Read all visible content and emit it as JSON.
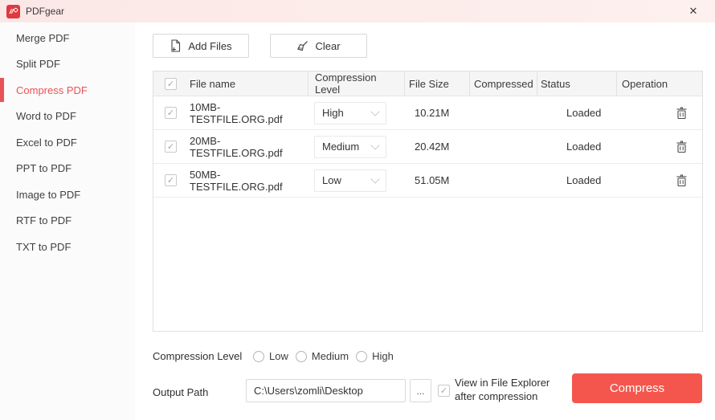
{
  "window": {
    "title": "PDFgear",
    "close_glyph": "✕"
  },
  "glyphs": {
    "check": "✓",
    "ellipsis": "..."
  },
  "sidebar": {
    "items": [
      {
        "label": "Merge PDF",
        "active": false
      },
      {
        "label": "Split PDF",
        "active": false
      },
      {
        "label": "Compress PDF",
        "active": true
      },
      {
        "label": "Word to PDF",
        "active": false
      },
      {
        "label": "Excel to PDF",
        "active": false
      },
      {
        "label": "PPT to PDF",
        "active": false
      },
      {
        "label": "Image to PDF",
        "active": false
      },
      {
        "label": "RTF to PDF",
        "active": false
      },
      {
        "label": "TXT to PDF",
        "active": false
      }
    ]
  },
  "toolbar": {
    "add_files_label": "Add Files",
    "clear_label": "Clear"
  },
  "table": {
    "columns": [
      "File name",
      "Compression Level",
      "File Size",
      "Compressed",
      "Status",
      "Operation"
    ],
    "rows": [
      {
        "checked": true,
        "file_name": "10MB-TESTFILE.ORG.pdf",
        "compression_level": "High",
        "file_size": "10.21M",
        "compressed": "",
        "status": "Loaded"
      },
      {
        "checked": true,
        "file_name": "20MB-TESTFILE.ORG.pdf",
        "compression_level": "Medium",
        "file_size": "20.42M",
        "compressed": "",
        "status": "Loaded"
      },
      {
        "checked": true,
        "file_name": "50MB-TESTFILE.ORG.pdf",
        "compression_level": "Low",
        "file_size": "51.05M",
        "compressed": "",
        "status": "Loaded"
      }
    ]
  },
  "controls": {
    "compression_level_label": "Compression Level",
    "radio_options": [
      "Low",
      "Medium",
      "High"
    ],
    "output_path_label": "Output Path",
    "output_path_value": "C:\\Users\\zomli\\Desktop",
    "view_in_explorer_label": "View in File Explorer after compression",
    "compress_label": "Compress"
  },
  "colors": {
    "accent_red": "#e85456",
    "compress_button": "#f4564d",
    "titlebar_bg": "#fcebe9"
  }
}
